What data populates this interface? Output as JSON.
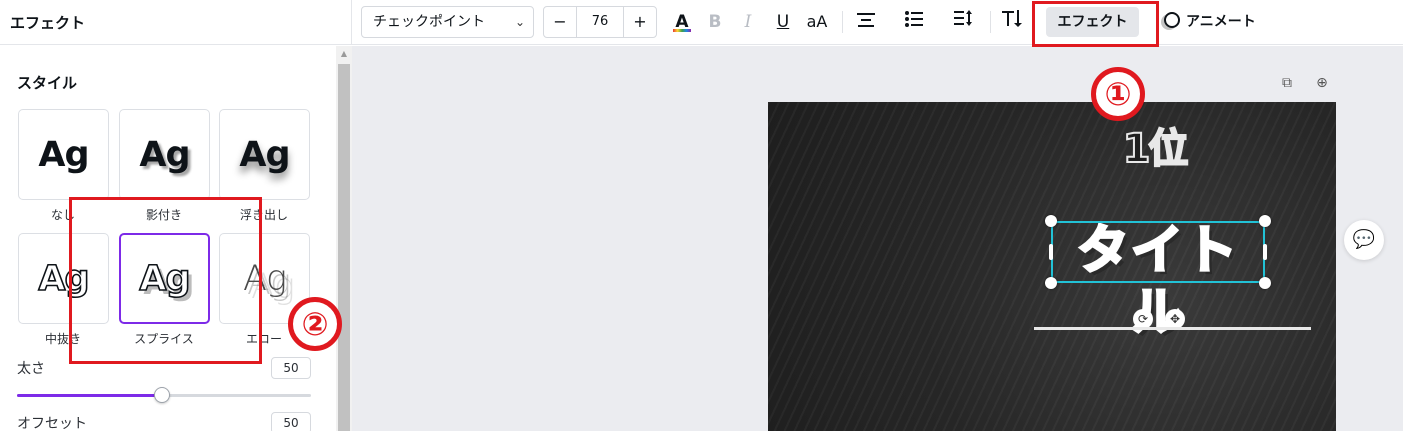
{
  "panel": {
    "title": "エフェクト",
    "section_title": "スタイル",
    "styles": [
      {
        "preview": "Ag",
        "label": "なし"
      },
      {
        "preview": "Ag",
        "label": "影付き"
      },
      {
        "preview": "Ag",
        "label": "浮き出し"
      },
      {
        "preview": "Ag",
        "label": "中抜き"
      },
      {
        "preview": "Ag",
        "label": "スプライス",
        "selected": true
      },
      {
        "preview": "Ag",
        "label": "エコー"
      }
    ],
    "thickness": {
      "label": "太さ",
      "value": "50"
    },
    "offset": {
      "label": "オフセット",
      "value": "50"
    }
  },
  "toolbar": {
    "font_name": "チェックポイント",
    "size_minus": "−",
    "font_size": "76",
    "size_plus": "+",
    "text_color_glyph": "A",
    "bold": "B",
    "italic": "I",
    "underline": "U",
    "case": "aA",
    "effect_label": "エフェクト",
    "animate_label": "アニメート"
  },
  "canvas": {
    "rank_text": "1位",
    "title_text": "タイトル"
  },
  "annotations": {
    "step1": "①",
    "step2": "②"
  },
  "colors": {
    "accent": "#7d2ae8",
    "annotation_red": "#e0191f",
    "selection": "#22c2d6"
  }
}
